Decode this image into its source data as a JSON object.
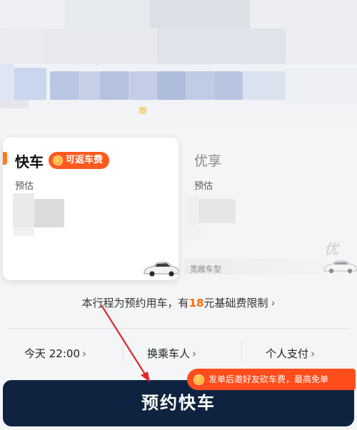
{
  "cards": [
    {
      "title": "快车",
      "badge": "可返车费",
      "estimate_label": "预估",
      "selected": true
    },
    {
      "title": "优享",
      "estimate_label": "预估",
      "tag": "宽敞车型",
      "watermark": "优",
      "selected": false
    }
  ],
  "notice": {
    "prefix": "本行程为预约用车，有",
    "amount": "18",
    "suffix": "元基础费限制",
    "chevron": "›"
  },
  "options": [
    {
      "label": "今天 22:00",
      "chevron": "›"
    },
    {
      "label": "换乘车人",
      "chevron": "›"
    },
    {
      "label": "个人支付",
      "chevron": "›"
    }
  ],
  "promo": {
    "text": "发单后邀好友砍车费，最高免单"
  },
  "main_button": {
    "label": "预约快车"
  },
  "icons": {
    "coin": "coin-icon",
    "car": "car-icon",
    "chevron": "chevron-right-icon"
  },
  "colors": {
    "accent": "#ff6a00",
    "badge": "#ff5a1e",
    "button": "#0f2340",
    "annotation": "#e0282c"
  }
}
